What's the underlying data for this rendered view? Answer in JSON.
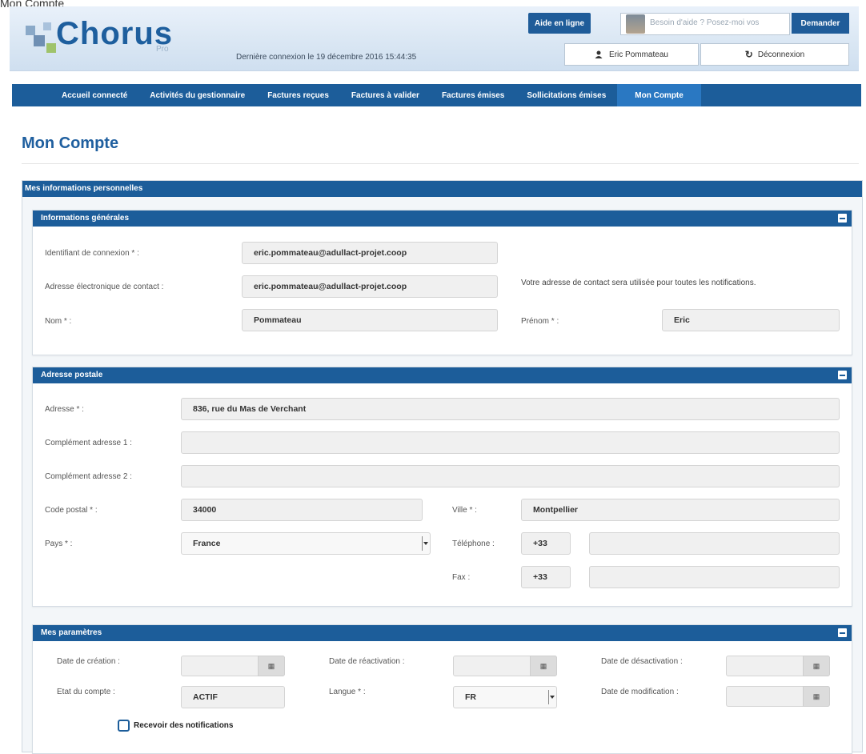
{
  "top_fragment": "Mon Compte",
  "header": {
    "logo_text": "Chorus",
    "logo_sub": "Pro",
    "last_connection": "Dernière connexion le 19 décembre 2016 15:44:35",
    "help_button": "Aide en ligne",
    "help_placeholder": "Besoin d'aide ? Posez-moi vos",
    "ask_button": "Demander",
    "user_name": "Eric Pommateau",
    "logout": "Déconnexion"
  },
  "nav": {
    "items": [
      "Accueil connecté",
      "Activités du gestionnaire",
      "Factures reçues",
      "Factures à valider",
      "Factures émises",
      "Sollicitations émises",
      "Mon Compte"
    ],
    "active_index": 6
  },
  "page_title": "Mon Compte",
  "personal": {
    "title": "Mes informations personnelles"
  },
  "general": {
    "title": "Informations générales",
    "login_label": "Identifiant de connexion * :",
    "login_value": "eric.pommateau@adullact-projet.coop",
    "email_label": "Adresse électronique de contact :",
    "email_value": "eric.pommateau@adullact-projet.coop",
    "email_note": "Votre adresse de contact sera utilisée pour toutes les notifications.",
    "nom_label": "Nom * :",
    "nom_value": "Pommateau",
    "prenom_label": "Prénom * :",
    "prenom_value": "Eric"
  },
  "address": {
    "title": "Adresse postale",
    "adresse_label": "Adresse * :",
    "adresse_value": "836, rue du Mas de Verchant",
    "comp1_label": "Complément adresse 1 :",
    "comp1_value": "",
    "comp2_label": "Complément adresse 2 :",
    "comp2_value": "",
    "cp_label": "Code postal * :",
    "cp_value": "34000",
    "ville_label": "Ville * :",
    "ville_value": "Montpellier",
    "pays_label": "Pays * :",
    "pays_value": "France",
    "tel_label": "Téléphone :",
    "tel_prefix": "+33",
    "tel_value": "",
    "fax_label": "Fax :",
    "fax_prefix": "+33",
    "fax_value": ""
  },
  "params": {
    "title": "Mes paramètres",
    "creation_label": "Date de création :",
    "creation_value": "",
    "reactivation_label": "Date de réactivation :",
    "reactivation_value": "",
    "desactivation_label": "Date de désactivation :",
    "desactivation_value": "",
    "etat_label": "Etat du compte :",
    "etat_value": "ACTIF",
    "langue_label": "Langue * :",
    "langue_value": "FR",
    "modification_label": "Date de modification :",
    "modification_value": "",
    "notif_label": "Recevoir des notifications",
    "notif_checked": false
  },
  "colors": {
    "primary": "#1c5d9a",
    "active_tab": "#2a78c2",
    "title": "#1f5f9f"
  }
}
